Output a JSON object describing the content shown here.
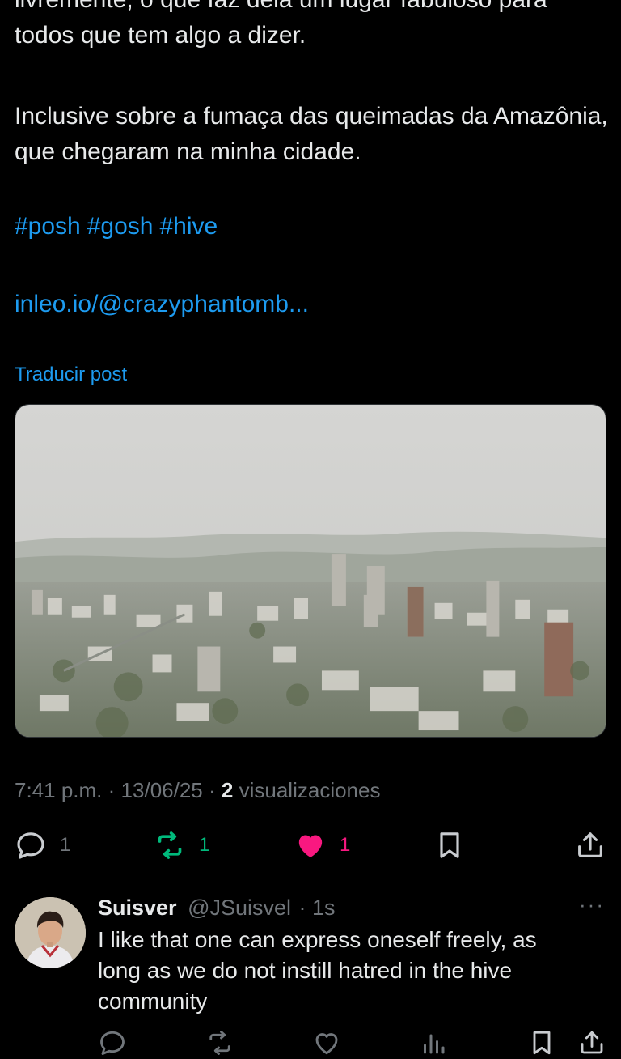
{
  "post": {
    "text_top": "livremente, o que faz dela um lugar fabuloso para todos que tem algo a dizer.",
    "text_p2": "Inclusive sobre a fumaça das queimadas da Amazônia, que chegaram na minha cidade.",
    "hashtags": [
      "#posh",
      "#gosh",
      "#hive"
    ],
    "link": "inleo.io/@crazyphantomb...",
    "translate_label": "Traducir post",
    "time": "7:41 p.m.",
    "date": "13/06/25",
    "views_count": "2",
    "views_label": "visualizaciones",
    "separator": "·"
  },
  "actions": {
    "replies": "1",
    "reposts": "1",
    "likes": "1"
  },
  "colors": {
    "accent": "#1d9bf0",
    "repost": "#00ba7c",
    "like": "#f91880",
    "muted": "#71767b"
  },
  "reply": {
    "name": "Suisver",
    "handle": "@JSuisvel",
    "time": "· 1s",
    "text": "I like that one can express oneself freely, as long as we do not instill hatred in the hive community",
    "more": "···"
  },
  "icons": [
    "reply-icon",
    "repost-icon",
    "heart-icon",
    "bookmark-icon",
    "share-icon",
    "views-icon",
    "more-icon"
  ]
}
